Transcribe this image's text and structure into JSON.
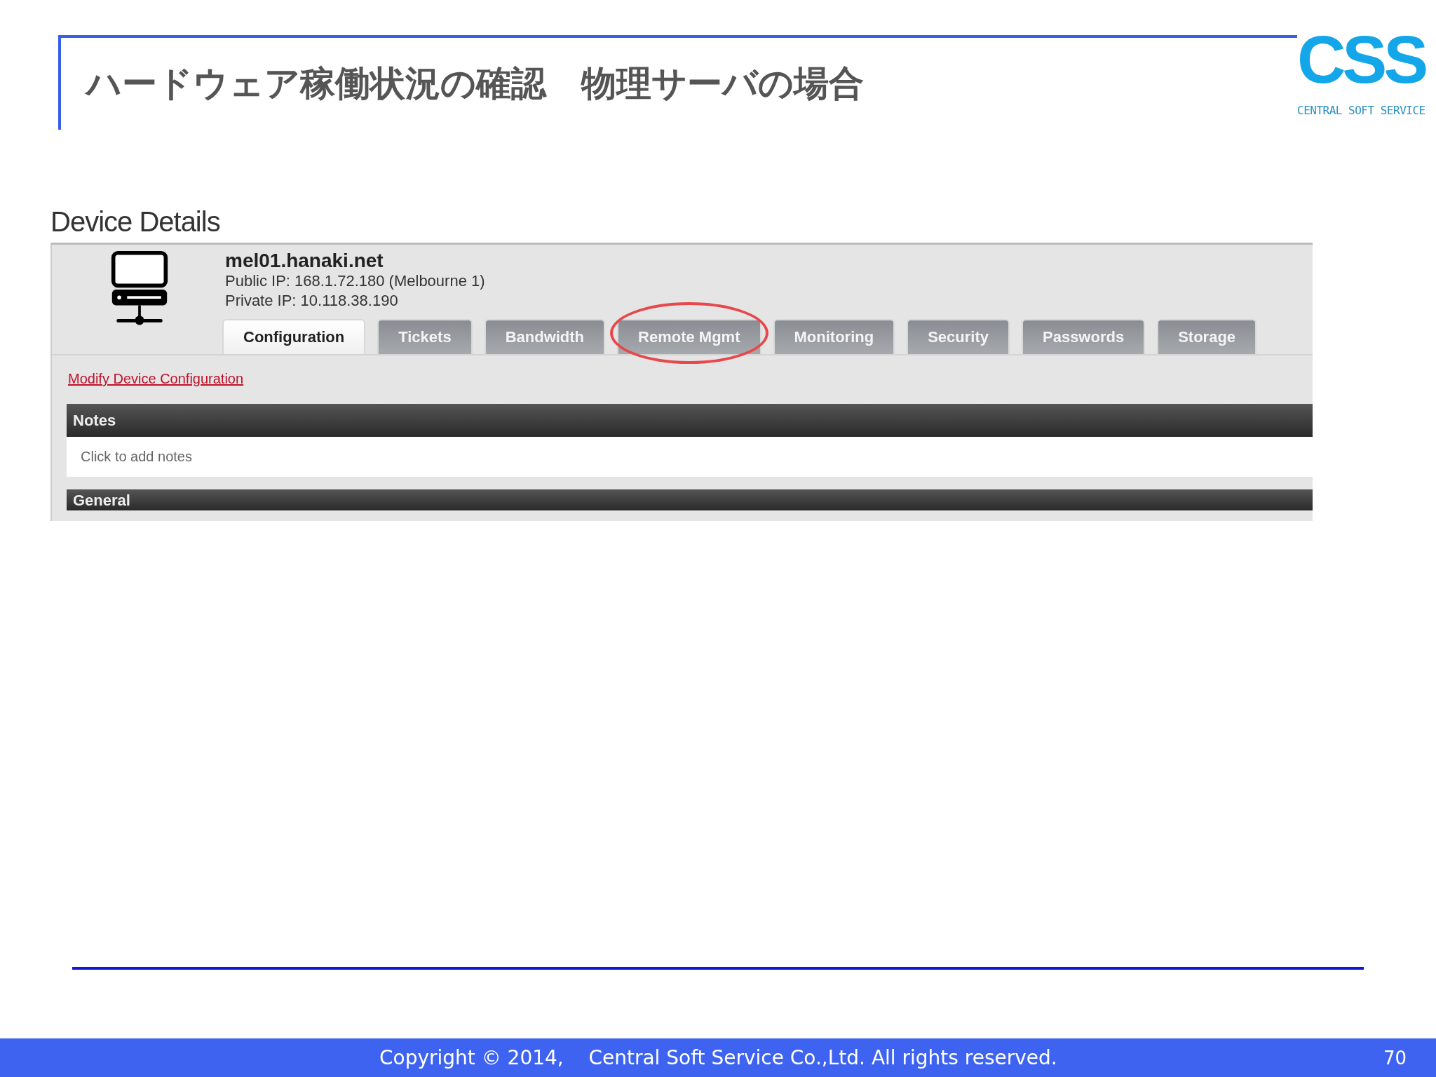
{
  "slide": {
    "title": "ハードウェア稼働状況の確認　物理サーバの場合",
    "page_number": "70"
  },
  "logo": {
    "text": "CSS",
    "tagline": "CENTRAL SOFT SERVICE"
  },
  "section_heading": "Device Details",
  "device": {
    "hostname": "mel01.hanaki.net",
    "public_ip": "Public IP: 168.1.72.180 (Melbourne 1)",
    "private_ip": "Private IP: 10.118.38.190"
  },
  "tabs": [
    {
      "label": "Configuration",
      "selected": true,
      "highlighted": false
    },
    {
      "label": "Tickets",
      "selected": false,
      "highlighted": false
    },
    {
      "label": "Bandwidth",
      "selected": false,
      "highlighted": false
    },
    {
      "label": "Remote Mgmt",
      "selected": false,
      "highlighted": true
    },
    {
      "label": "Monitoring",
      "selected": false,
      "highlighted": false
    },
    {
      "label": "Security",
      "selected": false,
      "highlighted": false
    },
    {
      "label": "Passwords",
      "selected": false,
      "highlighted": false
    },
    {
      "label": "Storage",
      "selected": false,
      "highlighted": false
    }
  ],
  "link": "Modify Device Configuration",
  "notes": {
    "title": "Notes",
    "placeholder": "Click to add notes"
  },
  "next_section": {
    "title": "General"
  },
  "footer": {
    "copyright": "Copyright © 2014,    Central Soft Service Co.,Ltd. All rights reserved."
  }
}
